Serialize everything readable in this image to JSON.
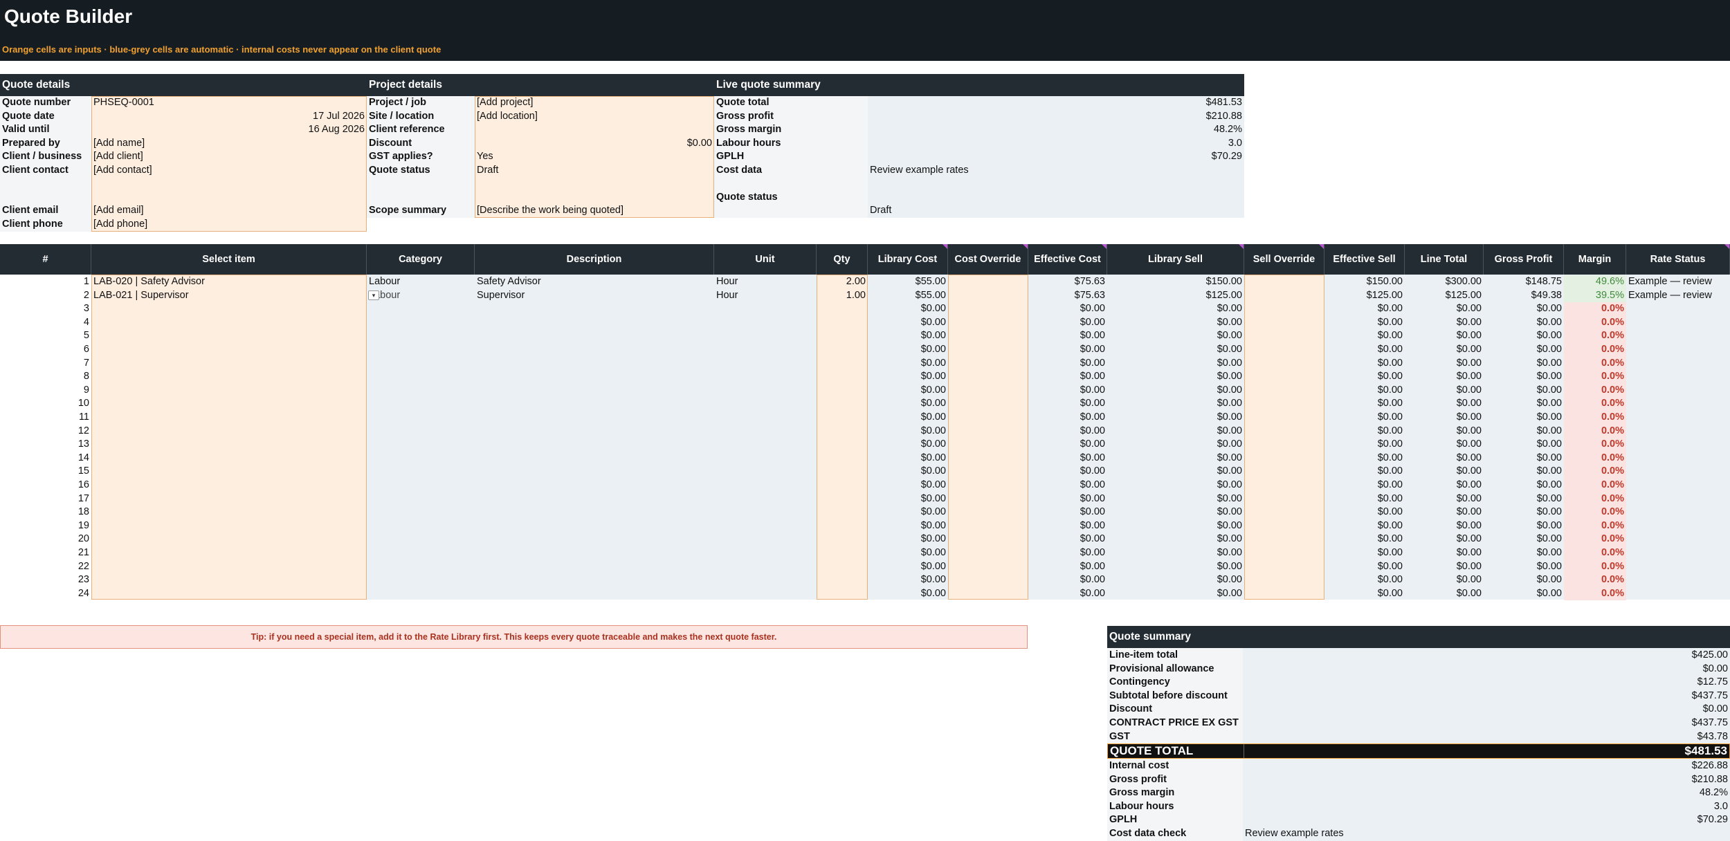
{
  "header": {
    "title": "Quote Builder",
    "subtitle": "Orange cells are inputs · blue-grey cells are automatic · internal costs never appear on the client quote"
  },
  "quote_details": {
    "heading": "Quote details",
    "fields": [
      {
        "label": "Quote number",
        "value": "PHSEQ-0001"
      },
      {
        "label": "Quote date",
        "value": "17 Jul 2026"
      },
      {
        "label": "Valid until",
        "value": "16 Aug 2026"
      },
      {
        "label": "Prepared by",
        "value": "[Add name]"
      },
      {
        "label": "Client / business",
        "value": "[Add client]"
      },
      {
        "label": "Client contact",
        "value": "[Add contact]"
      },
      {
        "label": "Client email",
        "value": "[Add email]"
      },
      {
        "label": "Client phone",
        "value": "[Add phone]"
      }
    ]
  },
  "project_details": {
    "heading": "Project details",
    "fields": [
      {
        "label": "Project / job",
        "value": "[Add project]"
      },
      {
        "label": "Site / location",
        "value": "[Add location]"
      },
      {
        "label": "Client reference",
        "value": ""
      },
      {
        "label": "Discount",
        "value": "$0.00"
      },
      {
        "label": "GST applies?",
        "value": "Yes"
      },
      {
        "label": "Quote status",
        "value": "Draft"
      },
      {
        "label": "Scope summary",
        "value": "[Describe the work being quoted]"
      }
    ]
  },
  "live_summary": {
    "heading": "Live quote summary",
    "fields": [
      {
        "label": "Quote total",
        "value": "$481.53"
      },
      {
        "label": "Gross profit",
        "value": "$210.88"
      },
      {
        "label": "Gross margin",
        "value": "48.2%"
      },
      {
        "label": "Labour hours",
        "value": "3.0"
      },
      {
        "label": "GPLH",
        "value": "$70.29"
      },
      {
        "label": "Cost data",
        "value": "Review example rates"
      },
      {
        "label": "Quote status",
        "value": "Draft"
      }
    ]
  },
  "line_items": {
    "columns": [
      "#",
      "Select item",
      "Category",
      "Description",
      "Unit",
      "Qty",
      "Library Cost",
      "Cost Override",
      "Effective Cost",
      "Library Sell",
      "Sell Override",
      "Effective Sell",
      "Line Total",
      "Gross Profit",
      "Margin",
      "Rate Status"
    ],
    "rows": [
      {
        "n": "1",
        "item": "LAB-020 | Safety Advisor",
        "category": "Labour",
        "description": "Safety Advisor",
        "unit": "Hour",
        "qty": "2.00",
        "lib_cost": "$55.00",
        "cost_override": "",
        "eff_cost": "$75.63",
        "lib_sell": "$150.00",
        "sell_override": "",
        "eff_sell": "$150.00",
        "line_total": "$300.00",
        "gross_profit": "$148.75",
        "margin": "49.6%",
        "rate_status": "Example — review"
      },
      {
        "n": "2",
        "item": "LAB-021 | Supervisor",
        "category": "Labour",
        "description": "Supervisor",
        "unit": "Hour",
        "qty": "1.00",
        "lib_cost": "$55.00",
        "cost_override": "",
        "eff_cost": "$75.63",
        "lib_sell": "$125.00",
        "sell_override": "",
        "eff_sell": "$125.00",
        "line_total": "$125.00",
        "gross_profit": "$49.38",
        "margin": "39.5%",
        "rate_status": "Example — review"
      }
    ],
    "empty_row_values": {
      "lib_cost": "$0.00",
      "eff_cost": "$0.00",
      "lib_sell": "$0.00",
      "eff_sell": "$0.00",
      "line_total": "$0.00",
      "gross_profit": "$0.00",
      "margin": "0.0%"
    },
    "empty_row_numbers": [
      "3",
      "4",
      "5",
      "6",
      "7",
      "8",
      "9",
      "10",
      "11",
      "12",
      "13",
      "14",
      "15",
      "16",
      "17",
      "18",
      "19",
      "20",
      "21",
      "22",
      "23",
      "24"
    ],
    "dropdown_glyph": "▾"
  },
  "tip": "Tip: if you need a special item, add it to the Rate Library first. This keeps every quote traceable and makes the next quote faster.",
  "quote_summary": {
    "heading": "Quote summary",
    "rows_before": [
      {
        "label": "Line-item total",
        "value": "$425.00"
      },
      {
        "label": "Provisional allowance",
        "value": "$0.00"
      },
      {
        "label": "Contingency",
        "value": "$12.75"
      },
      {
        "label": "Subtotal before discount",
        "value": "$437.75"
      },
      {
        "label": "Discount",
        "value": "$0.00"
      },
      {
        "label": "CONTRACT PRICE EX GST",
        "value": "$437.75"
      },
      {
        "label": "GST",
        "value": "$43.78"
      }
    ],
    "total": {
      "label": "QUOTE TOTAL",
      "value": "$481.53"
    },
    "rows_after": [
      {
        "label": "Internal cost",
        "value": "$226.88"
      },
      {
        "label": "Gross profit",
        "value": "$210.88"
      },
      {
        "label": "Gross margin",
        "value": "48.2%"
      },
      {
        "label": "Labour hours",
        "value": "3.0"
      },
      {
        "label": "GPLH",
        "value": "$70.29"
      },
      {
        "label": "Cost data check",
        "value": "Review example rates"
      }
    ]
  },
  "colors": {
    "banner": "#161d22",
    "section_header": "#232c33",
    "input_cell": "#fdeee0",
    "auto_cell": "#eaf0f3",
    "accent_orange": "#f0a030",
    "negative_margin": "#c0392b",
    "positive_margin": "#3f8a3a"
  }
}
